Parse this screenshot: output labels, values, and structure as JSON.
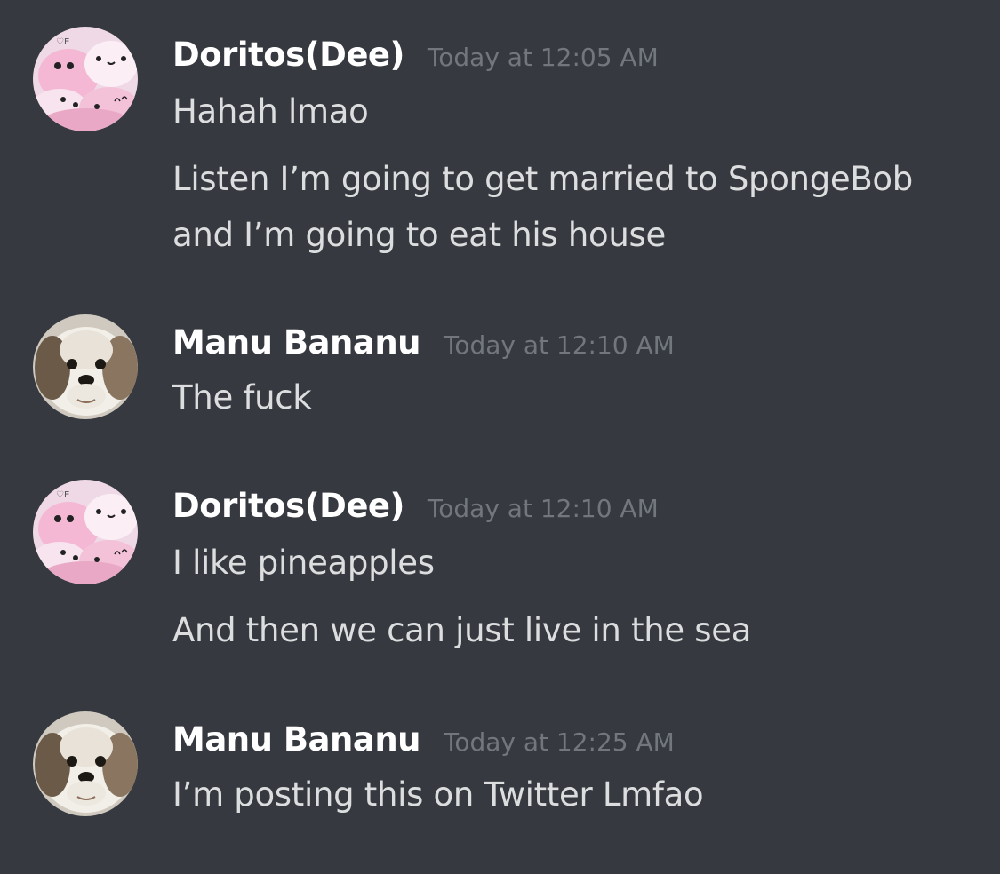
{
  "messages": [
    {
      "username": "Doritos(Dee)",
      "timestamp": "Today at 12:05 AM",
      "avatar_icon": "marshmallow-avatar-icon",
      "lines": [
        "Hahah lmao",
        "Listen I’m going to get married to SpongeBob",
        "and I’m going to eat his house"
      ]
    },
    {
      "username": "Manu Bananu",
      "timestamp": "Today at 12:10 AM",
      "avatar_icon": "dog-avatar-icon",
      "lines": [
        "The fuck"
      ]
    },
    {
      "username": "Doritos(Dee)",
      "timestamp": "Today at 12:10 AM",
      "avatar_icon": "marshmallow-avatar-icon",
      "lines": [
        "I like pineapples",
        "And then we can just live in the sea"
      ]
    },
    {
      "username": "Manu Bananu",
      "timestamp": "Today at 12:25 AM",
      "avatar_icon": "dog-avatar-icon",
      "lines": [
        "I’m posting this on Twitter Lmfao"
      ]
    }
  ],
  "colors": {
    "background": "#36393f",
    "username": "#ffffff",
    "timestamp": "#72767d",
    "message_text": "#dcddde"
  }
}
